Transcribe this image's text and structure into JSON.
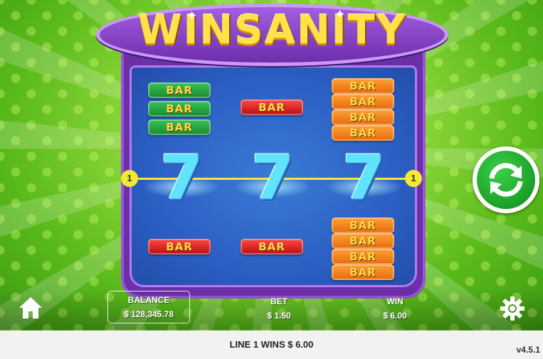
{
  "game": {
    "title": "WINSANITY",
    "payline_number": "1"
  },
  "reels": {
    "top": [
      {
        "symbol": "bar-triple-green",
        "labels": [
          "BAR",
          "BAR",
          "BAR"
        ]
      },
      {
        "symbol": "bar-single-red",
        "labels": [
          "BAR"
        ]
      },
      {
        "symbol": "bar-quad-orange",
        "labels": [
          "BAR",
          "BAR",
          "BAR",
          "BAR"
        ]
      }
    ],
    "middle": [
      "7",
      "7",
      "7"
    ],
    "bottom": [
      {
        "symbol": "bar-single-red",
        "labels": [
          "BAR"
        ]
      },
      {
        "symbol": "bar-single-red",
        "labels": [
          "BAR"
        ]
      },
      {
        "symbol": "bar-quad-orange",
        "labels": [
          "BAR",
          "BAR",
          "BAR",
          "BAR"
        ]
      }
    ]
  },
  "hud": {
    "balance_label": "BALANCE",
    "balance_value": "$ 128,345.78",
    "bet_label": "BET",
    "bet_value": "$ 1.50",
    "win_label": "WIN",
    "win_value": "$ 6.00"
  },
  "message": "LINE 1 WINS $ 6.00",
  "version": "v4.5.1",
  "colors": {
    "cabinet": "#6b2fa8",
    "reel_bg": "#2c5fc4",
    "payline": "#f4e832",
    "spin": "#0e8a1d",
    "logo": "#ffe24a"
  },
  "icons": [
    "home-icon",
    "spin-arrows-icon",
    "gear-icon"
  ]
}
